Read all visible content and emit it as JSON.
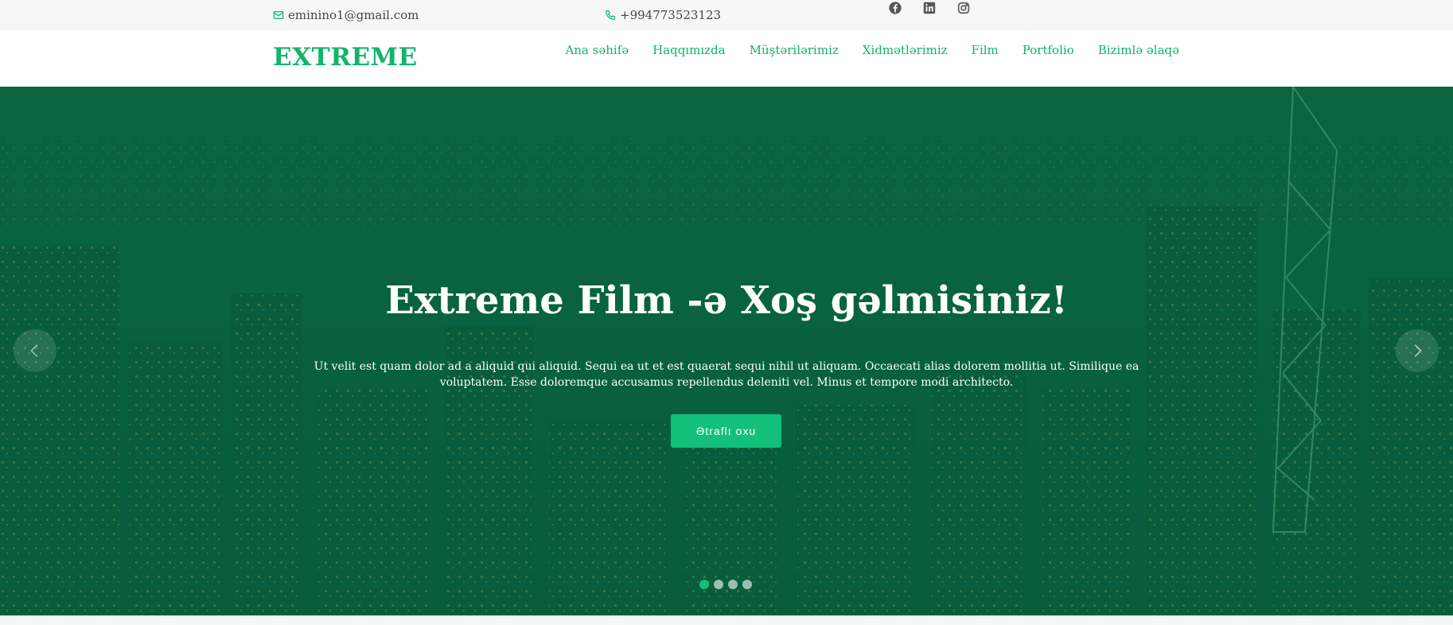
{
  "topbar": {
    "email": "eminino1@gmail.com",
    "phone": "+994773523123",
    "socials": [
      "facebook-icon",
      "linkedin-icon",
      "instagram-icon"
    ]
  },
  "header": {
    "logo": "EXTREME",
    "nav": [
      "Ana səhifə",
      "Haqqımızda",
      "Müştərilərimiz",
      "Xidmətlərimiz",
      "Film",
      "Portfolio",
      "Bizimlə əlaqə"
    ]
  },
  "hero": {
    "title": "Extreme Film -ə Xoş gəlmisiniz!",
    "text": "Ut velit est quam dolor ad a aliquid qui aliquid. Sequi ea ut et est quaerat sequi nihil ut aliquam. Occaecati alias dolorem mollitia ut. Similique ea voluptatem. Esse doloremque accusamus repellendus deleniti vel. Minus et tempore modi architecto.",
    "button": "Ətraflı oxu",
    "slides": 4,
    "active_slide": 1
  },
  "colors": {
    "accent": "#12b46c",
    "hero_overlay": "#0b6e48",
    "button": "#12c07a"
  }
}
